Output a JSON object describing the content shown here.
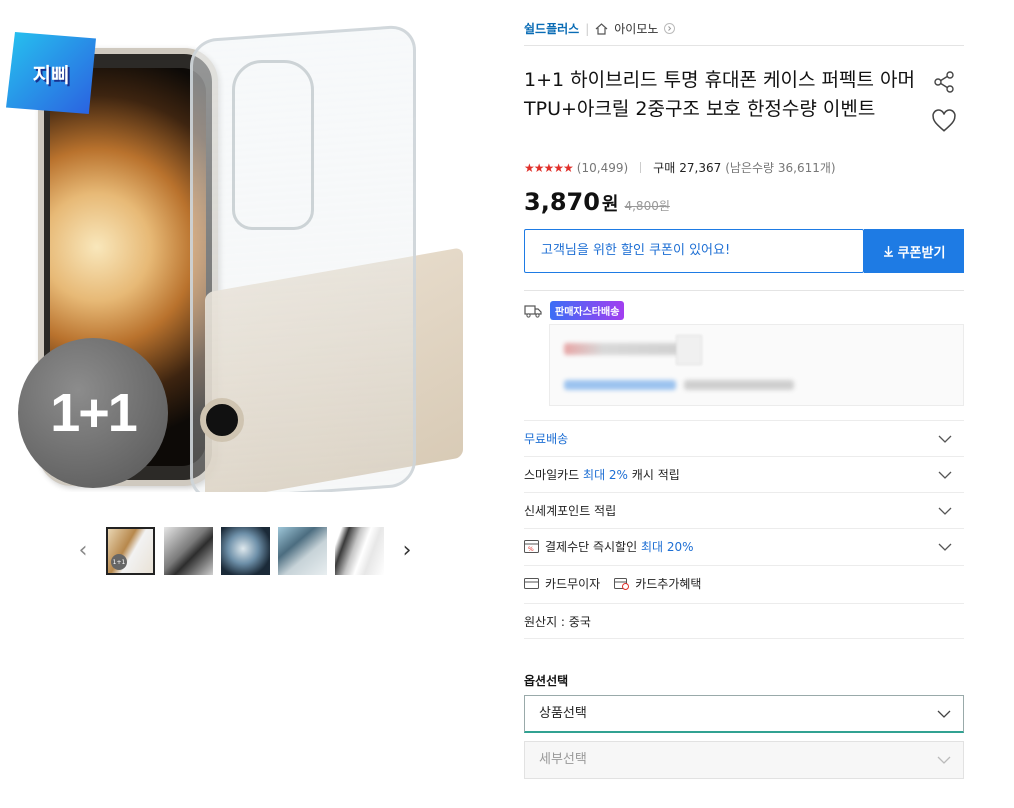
{
  "gallery": {
    "badge_text": "지삐",
    "main_overlay": "1+1",
    "thumb_overlay": "1+1",
    "thumbnails": [
      "thumb-1",
      "thumb-2",
      "thumb-3",
      "thumb-4",
      "thumb-5"
    ],
    "prev_icon": "chevron-left-icon",
    "next_icon": "chevron-right-icon"
  },
  "seller": {
    "shop_name": "쉴드플러스",
    "brand_name": "아이모노"
  },
  "product": {
    "title": "1+1 하이브리드 투명 휴대폰 케이스 퍼펙트 아머 TPU+아크릴 2중구조 보호 한정수량 이벤트",
    "stars": "★★★★★",
    "review_count": "(10,499)",
    "purchase_label": "구매",
    "purchase_count": "27,367",
    "remaining": "(남은수량 36,611개)",
    "price": "3,870",
    "price_unit": "원",
    "original_price": "4,800원"
  },
  "coupon": {
    "message": "고객님을 위한 할인 쿠폰이 있어요!",
    "button_label": "쿠폰받기"
  },
  "shipping": {
    "tag": "판매자스타배송"
  },
  "benefits": {
    "free_shipping": "무료배송",
    "smile_prefix": "스마일카드",
    "smile_highlight": "최대 2%",
    "smile_suffix": "캐시 적립",
    "shinsegae": "신세계포인트 적립",
    "payment_prefix": "결제수단 즉시할인",
    "payment_highlight": "최대 20%",
    "card_installment": "카드무이자",
    "card_extra": "카드추가혜택",
    "origin": "원산지 : 중국"
  },
  "options": {
    "title": "옵션선택",
    "product_select": "상품선택",
    "detail_select": "세부선택"
  },
  "colors": {
    "accent_blue": "#1e7be4",
    "link_blue": "#1e6fd4",
    "star_red": "#e0312b",
    "select_focus": "#31a292"
  }
}
